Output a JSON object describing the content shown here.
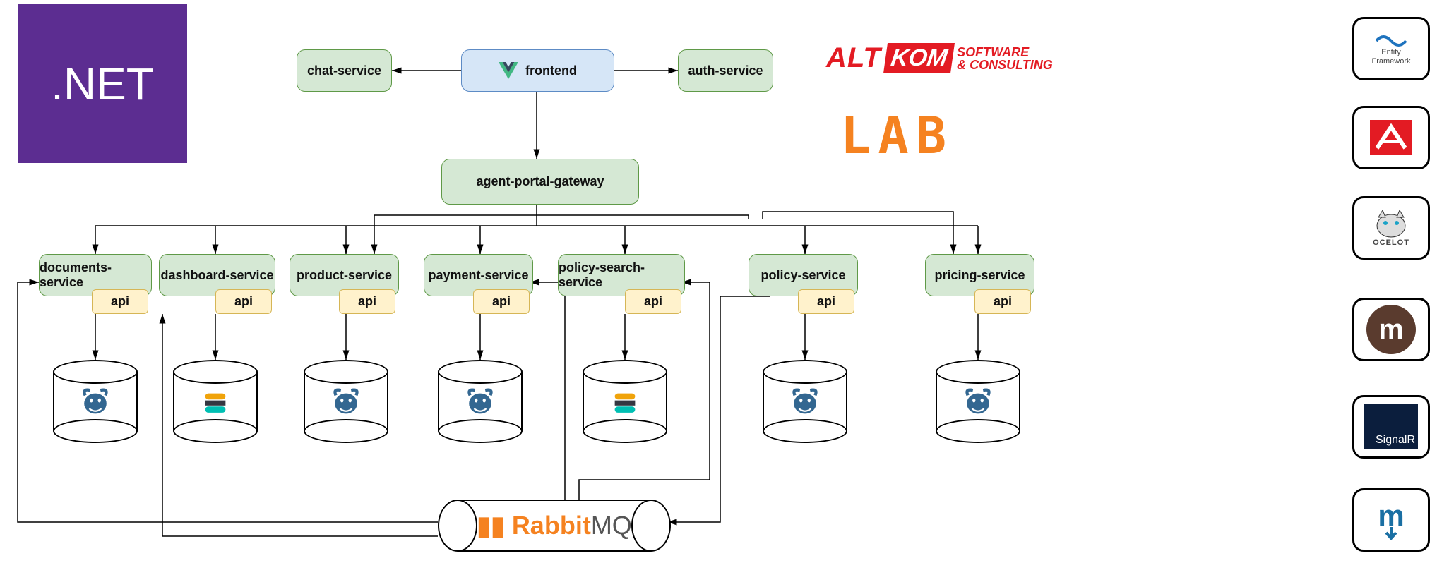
{
  "branding": {
    "dotnet": ".NET",
    "altkom_alt": "ALT",
    "altkom_kom": "KOM",
    "altkom_tag1": "SOFTWARE",
    "altkom_tag2": "& CONSULTING",
    "lab": "LAB"
  },
  "nodes": {
    "frontend": "frontend",
    "chat_service": "chat-service",
    "auth_service": "auth-service",
    "gateway": "agent-portal-gateway",
    "documents_service": "documents-service",
    "dashboard_service": "dashboard-service",
    "product_service": "product-service",
    "payment_service": "payment-service",
    "policy_search_service": "policy-search-service",
    "policy_service": "policy-service",
    "pricing_service": "pricing-service",
    "api": "api"
  },
  "queue": {
    "name_part1": "Rabbit",
    "name_part2": "MQ"
  },
  "tech_tiles": {
    "entity_framework_line1": "Entity",
    "entity_framework_line2": "Framework",
    "nhibernate": "",
    "ocelot": "OCELOT",
    "marten": "m",
    "signalr": "SignalR",
    "mediatr": "m"
  },
  "icons": {
    "postgres": "postgres-icon",
    "elastic": "elastic-icon",
    "vue": "vue-icon",
    "rabbit": "rabbit-icon"
  }
}
